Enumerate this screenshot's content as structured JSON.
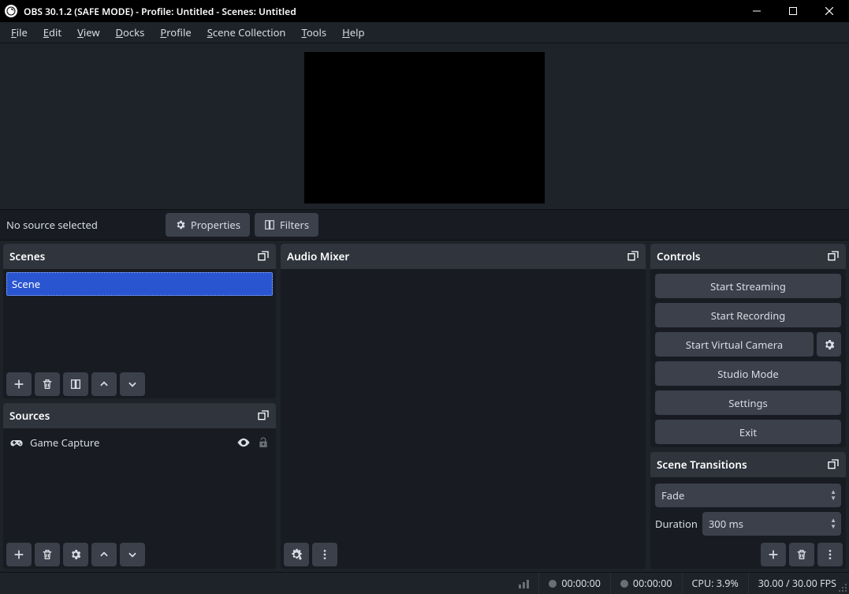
{
  "window": {
    "title": "OBS 30.1.2 (SAFE MODE) - Profile: Untitled - Scenes: Untitled"
  },
  "menu": {
    "file": "File",
    "edit": "Edit",
    "view": "View",
    "docks": "Docks",
    "profile": "Profile",
    "scene_collection": "Scene Collection",
    "tools": "Tools",
    "help": "Help"
  },
  "source_bar": {
    "no_source": "No source selected",
    "properties": "Properties",
    "filters": "Filters"
  },
  "panels": {
    "scenes": {
      "title": "Scenes",
      "items": [
        {
          "name": "Scene",
          "selected": true
        }
      ]
    },
    "sources": {
      "title": "Sources",
      "items": [
        {
          "name": "Game Capture",
          "visible": true,
          "locked": false
        }
      ]
    },
    "mixer": {
      "title": "Audio Mixer"
    },
    "controls": {
      "title": "Controls",
      "start_streaming": "Start Streaming",
      "start_recording": "Start Recording",
      "start_vcam": "Start Virtual Camera",
      "studio_mode": "Studio Mode",
      "settings": "Settings",
      "exit": "Exit"
    },
    "transitions": {
      "title": "Scene Transitions",
      "current": "Fade",
      "duration_label": "Duration",
      "duration_value": "300 ms"
    }
  },
  "status": {
    "stream_time": "00:00:00",
    "rec_time": "00:00:00",
    "cpu": "CPU: 3.9%",
    "fps": "30.00 / 30.00 FPS"
  }
}
